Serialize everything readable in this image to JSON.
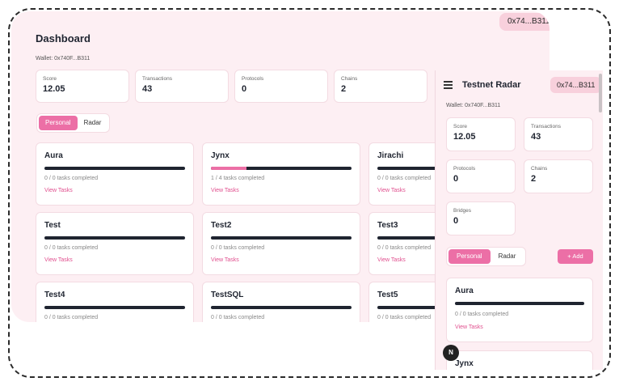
{
  "desktop": {
    "wallet_pill": "0x74...B311",
    "title": "Dashboard",
    "wallet_line": "Wallet: 0x740F...B311",
    "stats": [
      {
        "label": "Score",
        "value": "12.05"
      },
      {
        "label": "Transactions",
        "value": "43"
      },
      {
        "label": "Protocols",
        "value": "0"
      },
      {
        "label": "Chains",
        "value": "2"
      }
    ],
    "tabs": [
      "Personal",
      "Radar"
    ],
    "cards": [
      {
        "title": "Aura",
        "progress": 0,
        "meta": "0 / 0 tasks completed",
        "link": "View Tasks"
      },
      {
        "title": "Jynx",
        "progress": 0.25,
        "meta": "1 / 4 tasks completed",
        "link": "View Tasks"
      },
      {
        "title": "Jirachi",
        "progress": 0,
        "meta": "0 / 0 tasks completed",
        "link": "View Tasks"
      },
      {
        "title": "Test",
        "progress": 0,
        "meta": "0 / 0 tasks completed",
        "link": "View Tasks"
      },
      {
        "title": "Test2",
        "progress": 0,
        "meta": "0 / 0 tasks completed",
        "link": "View Tasks"
      },
      {
        "title": "Test3",
        "progress": 0,
        "meta": "0 / 0 tasks completed",
        "link": "View Tasks"
      },
      {
        "title": "Test4",
        "progress": 0,
        "meta": "0 / 0 tasks completed",
        "link": "View Tasks"
      },
      {
        "title": "TestSQL",
        "progress": 0,
        "meta": "0 / 0 tasks completed",
        "link": "View Tasks"
      },
      {
        "title": "Test5",
        "progress": 0,
        "meta": "0 / 0 tasks completed",
        "link": "View Tasks"
      }
    ]
  },
  "mobile": {
    "app_title": "Testnet Radar",
    "wallet_pill": "0x74...B311",
    "wallet_line": "Wallet: 0x740F...B311",
    "stats": [
      {
        "label": "Score",
        "value": "12.05"
      },
      {
        "label": "Transactions",
        "value": "43"
      },
      {
        "label": "Protocols",
        "value": "0"
      },
      {
        "label": "Chains",
        "value": "2"
      },
      {
        "label": "Bridges",
        "value": "0"
      }
    ],
    "tabs": [
      "Personal",
      "Radar"
    ],
    "add_label": "+ Add",
    "cards": [
      {
        "title": "Aura",
        "meta": "0 / 0 tasks completed",
        "link": "View Tasks"
      },
      {
        "title": "Jynx"
      }
    ]
  },
  "badge": "N",
  "colors": {
    "accent": "#ec6fa6",
    "background": "#fdeff3",
    "pill": "#f8d0dc",
    "bar": "#1f2430"
  },
  "icons": {
    "menu": "menu-icon",
    "plus": "plus-icon"
  }
}
